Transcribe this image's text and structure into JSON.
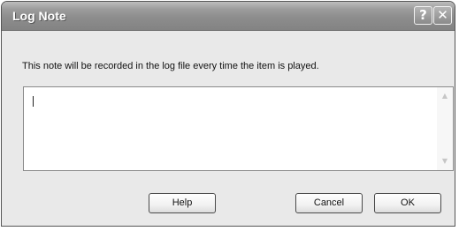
{
  "window": {
    "title": "Log Note",
    "help_glyph": "?",
    "close_glyph": "✕"
  },
  "message": "This note will be recorded in the log file every time the item is played.",
  "note": {
    "value": "",
    "scroll_up_glyph": "▲",
    "scroll_down_glyph": "▼"
  },
  "buttons": {
    "help": "Help",
    "cancel": "Cancel",
    "ok": "OK"
  }
}
